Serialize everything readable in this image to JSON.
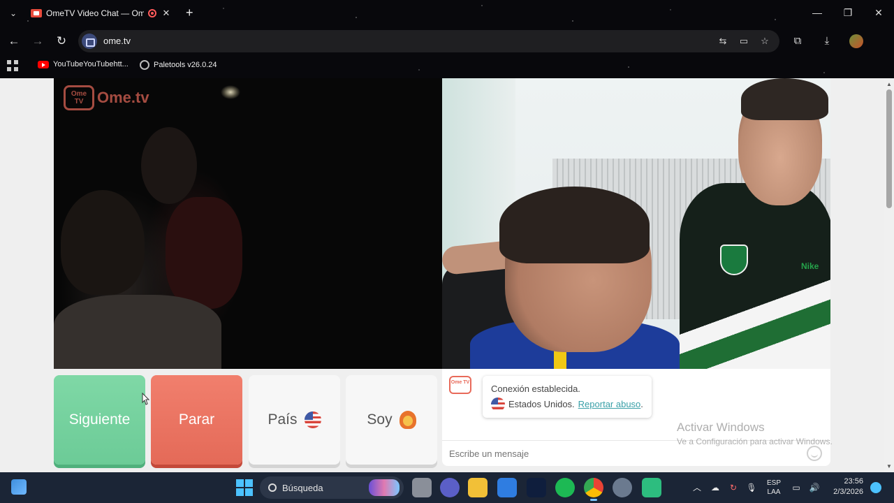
{
  "browser": {
    "tab_title": "OmeTV Video Chat — Ome",
    "tab_close": "✕",
    "new_tab": "+",
    "url": "ome.tv",
    "bookmarks": [
      "YouTubeYouTubehtt...",
      "Paletools v26.0.24"
    ],
    "window_controls": [
      "—",
      "❐",
      "✕"
    ]
  },
  "page": {
    "logo_text": "Ome.tv",
    "logo_icon_text": "Ome TV",
    "buttons": {
      "next": "Siguiente",
      "stop": "Parar",
      "country": "País",
      "gender": "Soy"
    },
    "chat": {
      "logo_text": "Ome TV",
      "status": "Conexión establecida.",
      "country": "Estados Unidos.",
      "report": "Reportar abuso",
      "report_suffix": ".",
      "placeholder": "Escribe un mensaje"
    },
    "self_sponsor": "Nike"
  },
  "watermark": {
    "title": "Activar Windows",
    "subtitle": "Ve a Configuración para activar Windows."
  },
  "taskbar": {
    "search": "Búsqueda",
    "lang_top": "ESP",
    "lang_bottom": "LAA",
    "time": "23:56",
    "date": "2/3/2026"
  },
  "colors": {
    "next": "#6ccb97",
    "stop": "#e46a58",
    "brand": "#e86a5a",
    "link": "#3aa0a8"
  }
}
